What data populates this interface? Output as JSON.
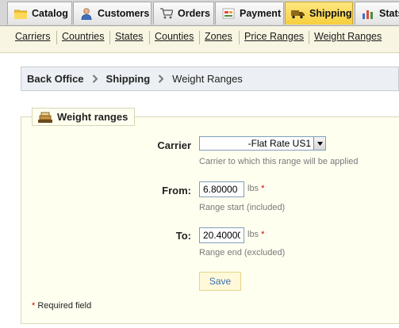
{
  "top_tabs": [
    {
      "label": "Catalog",
      "icon": "folder-icon"
    },
    {
      "label": "Customers",
      "icon": "customer-icon"
    },
    {
      "label": "Orders",
      "icon": "cart-icon"
    },
    {
      "label": "Payment",
      "icon": "payment-icon"
    },
    {
      "label": "Shipping",
      "icon": "truck-icon",
      "active": true
    },
    {
      "label": "Stats",
      "icon": "chart-icon"
    }
  ],
  "sub_tabs": [
    "Carriers",
    "Countries",
    "States",
    "Counties",
    "Zones",
    "Price Ranges",
    "Weight Ranges"
  ],
  "breadcrumb": [
    "Back Office",
    "Shipping",
    "Weight Ranges"
  ],
  "legend": "Weight ranges",
  "form": {
    "carrier_label": "Carrier",
    "carrier_value": "-Flat Rate US1",
    "carrier_hint": "Carrier to which this range will be applied",
    "from_label": "From:",
    "from_value": "6.80000",
    "from_unit": "lbs",
    "from_hint": "Range start (included)",
    "to_label": "To:",
    "to_value": "20.40000",
    "to_unit": "lbs",
    "to_hint": "Range end (excluded)",
    "required_mark": "*",
    "save_label": "Save",
    "required_note_mark": "*",
    "required_note": "Required field"
  },
  "colors": {
    "active_tab": "#f7cf3d",
    "subbar_bg": "#f8f6e2",
    "fieldset_bg": "#fffff0",
    "required": "#d20000",
    "save_text": "#3a6fb4"
  }
}
